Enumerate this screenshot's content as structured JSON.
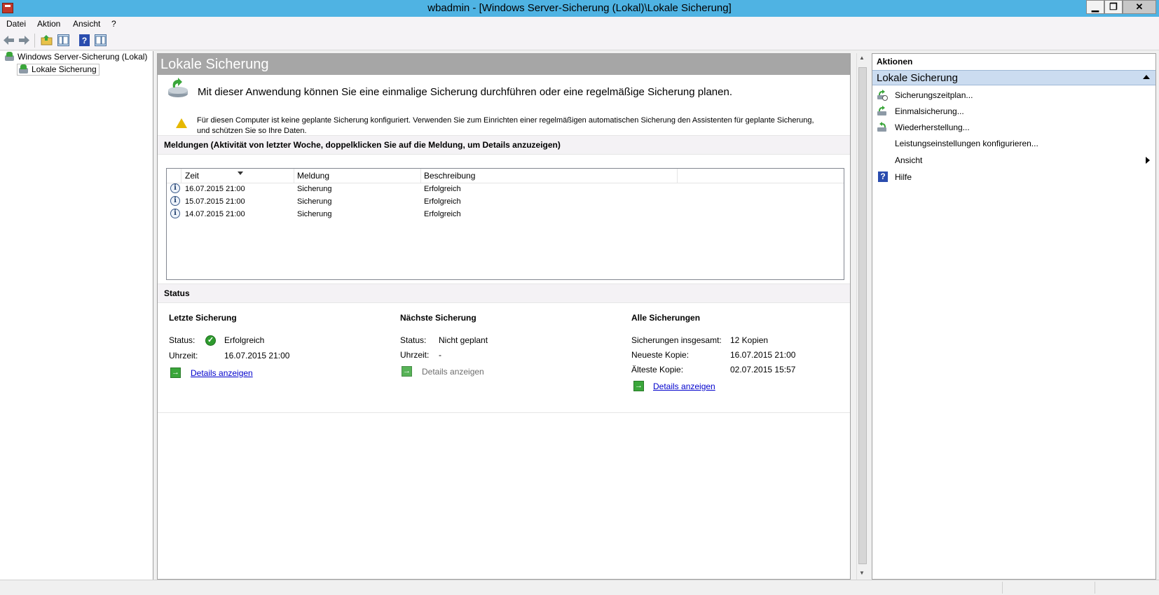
{
  "window": {
    "title": "wbadmin - [Windows Server-Sicherung (Lokal)\\Lokale Sicherung]",
    "min": "▁",
    "restore": "❐",
    "close": "✕"
  },
  "menu": [
    "Datei",
    "Aktion",
    "Ansicht",
    "?"
  ],
  "toolbar": {
    "icons": [
      "back-icon",
      "forward-icon",
      "up-folder-icon",
      "show-hide-tree-icon",
      "help-icon",
      "show-hide-action-pane-icon"
    ]
  },
  "tree": {
    "root": "Windows Server-Sicherung (Lokal)",
    "child": "Lokale Sicherung"
  },
  "main": {
    "header": "Lokale Sicherung",
    "intro": "Mit dieser Anwendung können Sie eine einmalige Sicherung durchführen oder eine regelmäßige Sicherung planen.",
    "warning": "Für diesen Computer ist keine geplante Sicherung konfiguriert. Verwenden Sie zum Einrichten einer regelmäßigen automatischen Sicherung den Assistenten für geplante Sicherung, und schützen Sie so Ihre Daten.",
    "messages_title": "Meldungen (Aktivität von letzter Woche, doppelklicken Sie auf die Meldung, um Details anzuzeigen)",
    "columns": [
      "Zeit",
      "Meldung",
      "Beschreibung"
    ],
    "rows": [
      {
        "time": "16.07.2015 21:00",
        "message": "Sicherung",
        "description": "Erfolgreich"
      },
      {
        "time": "15.07.2015 21:00",
        "message": "Sicherung",
        "description": "Erfolgreich"
      },
      {
        "time": "14.07.2015 21:00",
        "message": "Sicherung",
        "description": "Erfolgreich"
      }
    ],
    "status_title": "Status",
    "last": {
      "title": "Letzte Sicherung",
      "status_label": "Status:",
      "status_value": "Erfolgreich",
      "time_label": "Uhrzeit:",
      "time_value": "16.07.2015 21:00",
      "details": "Details anzeigen"
    },
    "next": {
      "title": "Nächste Sicherung",
      "status_label": "Status:",
      "status_value": "Nicht geplant",
      "time_label": "Uhrzeit:",
      "time_value": "-",
      "details": "Details anzeigen"
    },
    "all": {
      "title": "Alle Sicherungen",
      "total_label": "Sicherungen insgesamt:",
      "total_value": "12 Kopien",
      "newest_label": "Neueste Kopie:",
      "newest_value": "16.07.2015 21:00",
      "oldest_label": "Älteste Kopie:",
      "oldest_value": "02.07.2015 15:57",
      "details": "Details anzeigen"
    }
  },
  "actions": {
    "title": "Aktionen",
    "section": "Lokale Sicherung",
    "items": [
      "Sicherungszeitplan...",
      "Einmalsicherung...",
      "Wiederherstellung...",
      "Leistungseinstellungen konfigurieren...",
      "Ansicht",
      "Hilfe"
    ]
  }
}
